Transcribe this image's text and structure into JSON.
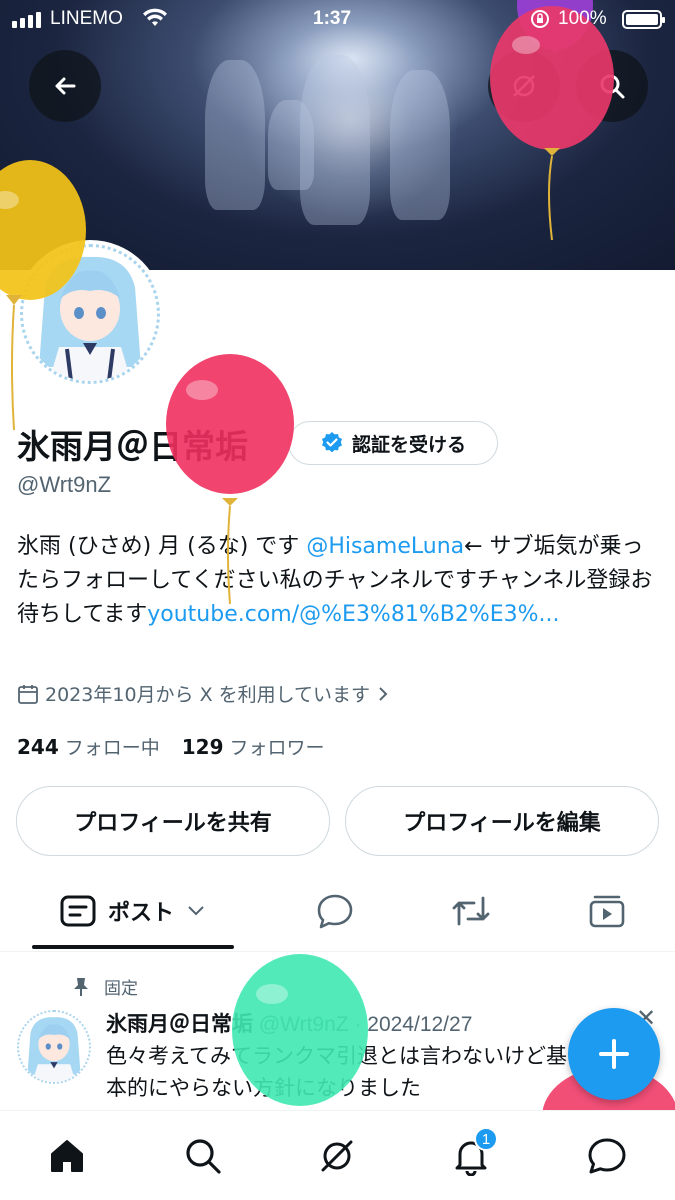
{
  "status_bar": {
    "carrier": "LINEMO",
    "time": "1:37",
    "battery": "100%"
  },
  "profile": {
    "display_name": "氷雨月＠日常垢",
    "verify_label": "認証を受ける",
    "handle": "@Wrt9nZ",
    "bio_part1": "氷雨 (ひさめ) 月 (るな) です ",
    "bio_mention": "@HisameLuna",
    "bio_part2": "← サブ垢気が乗ったらフォローしてください私のチャンネルですチャンネル登録お待ちしてます",
    "bio_link": "youtube.com/@%E3%81%B2%E3%...",
    "joined": "2023年10月から X を利用しています",
    "following_count": "244",
    "following_label": "フォロー中",
    "followers_count": "129",
    "followers_label": "フォロワー",
    "share_button": "プロフィールを共有",
    "edit_button": "プロフィールを編集"
  },
  "tabs": {
    "posts_label": "ポスト"
  },
  "pinned_post": {
    "pinned_label": "固定",
    "author": "氷雨月＠日常垢",
    "meta": " @Wrt9nZ · 2024/12/27",
    "text": "色々考えてみてランクマ引退とは言わないけど基本的にやらない方針になりました"
  },
  "notifications": {
    "badge_count": "1"
  },
  "colors": {
    "accent": "#1d9bf0",
    "text": "#0f1419",
    "secondary_text": "#536471"
  }
}
